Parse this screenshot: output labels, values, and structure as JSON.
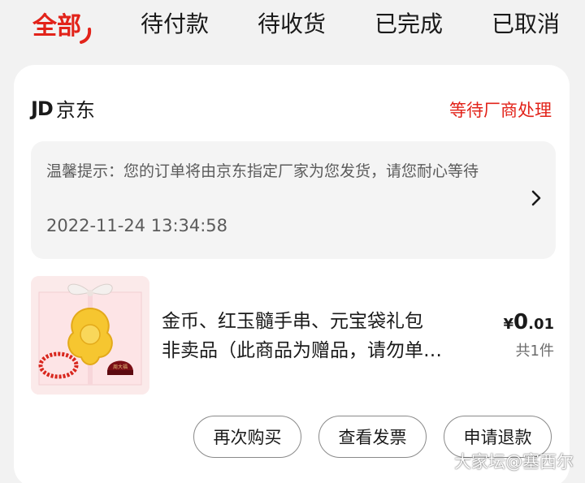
{
  "tabs": [
    {
      "label": "全部",
      "active": true
    },
    {
      "label": "待付款",
      "active": false
    },
    {
      "label": "待收货",
      "active": false
    },
    {
      "label": "已完成",
      "active": false
    },
    {
      "label": "已取消",
      "active": false
    }
  ],
  "order": {
    "logo": "JD",
    "shop_name": "京东",
    "status": "等待厂商处理",
    "notice": {
      "text": "温馨提示：您的订单将由京东指定厂家为您发货，请您耐心等待",
      "time": "2022-11-24 13:34:58"
    },
    "product": {
      "title_line1": "金币、红玉髓手串、元宝袋礼包",
      "title_line2": "非卖品（此商品为赠品，请勿单…",
      "price_currency": "¥",
      "price_int": "0",
      "price_dec": ".01",
      "quantity": "共1件",
      "thumb_brand": "周大福"
    },
    "actions": {
      "buy_again": "再次购买",
      "view_invoice": "查看发票",
      "refund": "申请退款"
    }
  },
  "watermark": "大家坛@塞西尔",
  "colors": {
    "accent": "#e2231a",
    "page_bg": "#f2f2f2",
    "card_bg": "#ffffff",
    "notice_bg": "#f4f4f4"
  }
}
